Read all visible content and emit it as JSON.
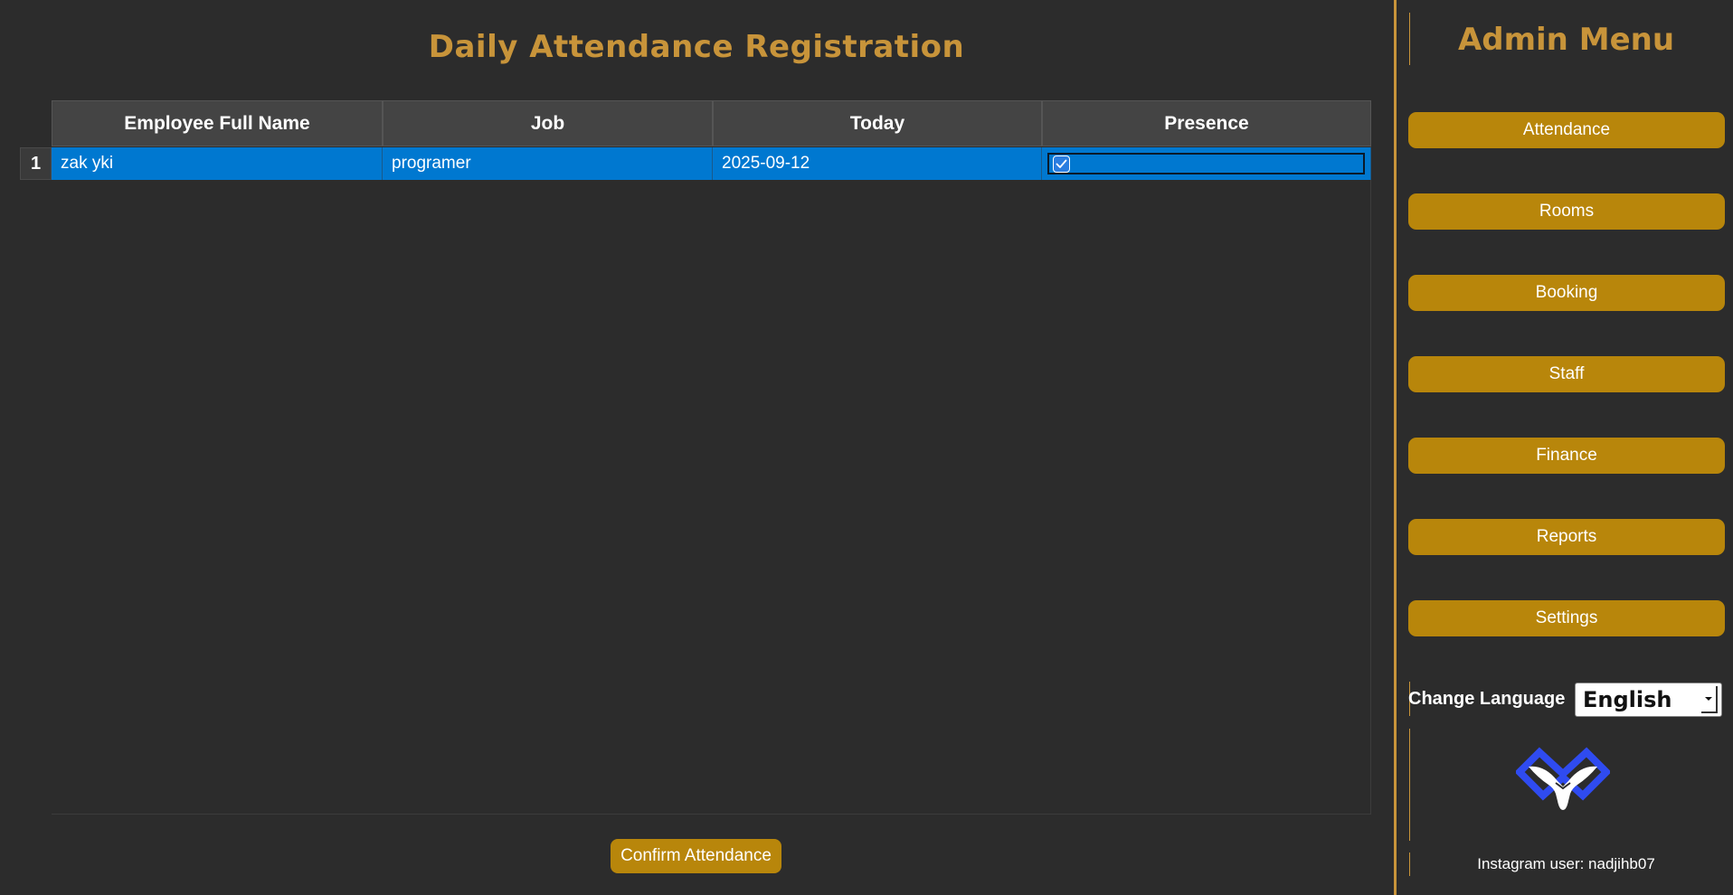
{
  "page_title": "Daily Attendance Registration",
  "table": {
    "headers": [
      "Employee Full Name",
      "Job",
      "Today",
      "Presence"
    ],
    "rows": [
      {
        "row_number": "1",
        "name": "zak yki",
        "job": "programer",
        "today": "2025-09-12",
        "present": true
      }
    ]
  },
  "confirm_label": "Confirm Attendance",
  "sidebar": {
    "title": "Admin Menu",
    "items": [
      {
        "label": "Attendance"
      },
      {
        "label": "Rooms"
      },
      {
        "label": "Booking"
      },
      {
        "label": "Staff"
      },
      {
        "label": "Finance"
      },
      {
        "label": "Reports"
      },
      {
        "label": "Settings"
      }
    ],
    "language_label": "Change Language",
    "language_selected": "English",
    "footer": "Instagram user: nadjihb07"
  },
  "colors": {
    "background": "#2c2c2c",
    "accent_gold": "#c8943a",
    "button_gold": "#b8860b",
    "selection_blue": "#0078d0",
    "logo_blue": "#2f4bf0"
  },
  "icons": {
    "checkbox": "checkmark-icon",
    "logo": "eagle-logo-icon",
    "dropdown": "chevron-down-icon"
  }
}
